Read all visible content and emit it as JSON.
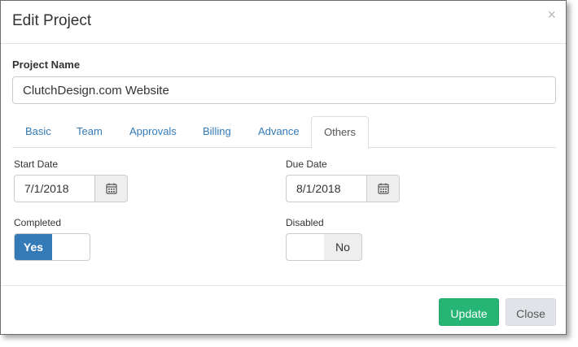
{
  "modal": {
    "title": "Edit Project",
    "close_glyph": "×"
  },
  "project_name": {
    "label": "Project Name",
    "value": "ClutchDesign.com Website"
  },
  "tabs": [
    {
      "label": "Basic",
      "active": false
    },
    {
      "label": "Team",
      "active": false
    },
    {
      "label": "Approvals",
      "active": false
    },
    {
      "label": "Billing",
      "active": false
    },
    {
      "label": "Advance",
      "active": false
    },
    {
      "label": "Others",
      "active": true
    }
  ],
  "start_date": {
    "label": "Start Date",
    "value": "7/1/2018",
    "icon": "calendar-icon"
  },
  "due_date": {
    "label": "Due Date",
    "value": "8/1/2018",
    "icon": "calendar-icon"
  },
  "completed": {
    "label": "Completed",
    "state": "Yes"
  },
  "disabled": {
    "label": "Disabled",
    "state": "No"
  },
  "footer": {
    "update_label": "Update",
    "close_label": "Close"
  },
  "colors": {
    "primary": "#337ab7",
    "success": "#26b574",
    "link": "#337ab7"
  }
}
